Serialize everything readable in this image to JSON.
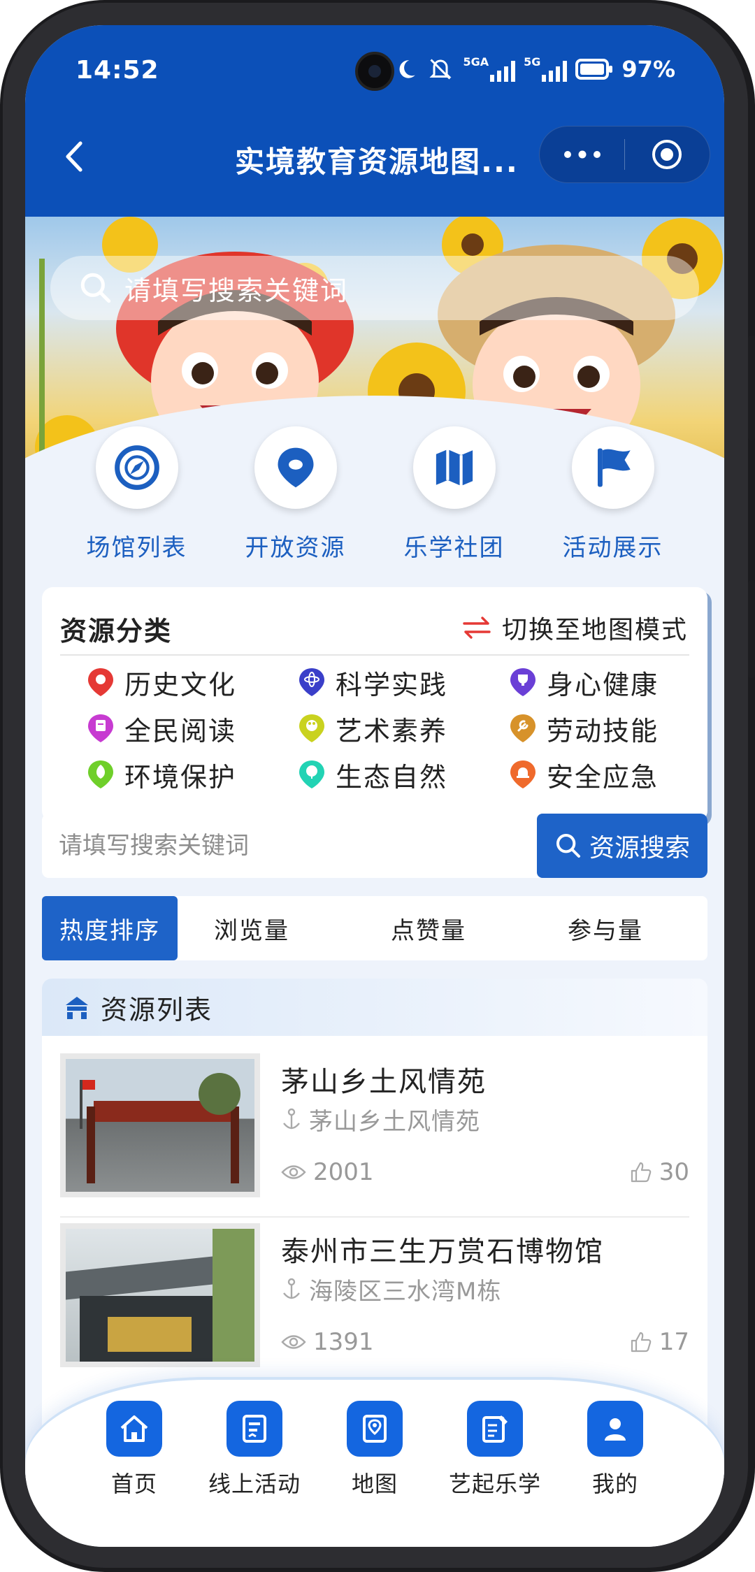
{
  "status": {
    "time": "14:52",
    "battery": "97%",
    "net1": "5GA",
    "net2": "5G"
  },
  "nav": {
    "title": "实境教育资源地图...",
    "more_icon": "more-dots-icon",
    "target_icon": "record-circle-icon"
  },
  "banner": {
    "search_placeholder": "请填写搜索关键词"
  },
  "quick": [
    {
      "label": "场馆列表",
      "icon": "compass-icon"
    },
    {
      "label": "开放资源",
      "icon": "location-pin-icon"
    },
    {
      "label": "乐学社团",
      "icon": "map-icon"
    },
    {
      "label": "活动展示",
      "icon": "flag-icon"
    }
  ],
  "categories": {
    "title": "资源分类",
    "switch_label": "切换至地图模式",
    "items": [
      {
        "label": "历史文化",
        "color": "#e53935"
      },
      {
        "label": "科学实践",
        "color": "#3a3fc9"
      },
      {
        "label": "身心健康",
        "color": "#6a3fd6"
      },
      {
        "label": "全民阅读",
        "color": "#c73bd1"
      },
      {
        "label": "艺术素养",
        "color": "#c9d21f"
      },
      {
        "label": "劳动技能",
        "color": "#d7922a"
      },
      {
        "label": "环境保护",
        "color": "#6fcf2a"
      },
      {
        "label": "生态自然",
        "color": "#22d3b4"
      },
      {
        "label": "安全应急",
        "color": "#ef6a2c"
      }
    ]
  },
  "search": {
    "placeholder": "请填写搜索关键词",
    "button": "资源搜索"
  },
  "sort": {
    "tabs": [
      "热度排序",
      "浏览量",
      "点赞量",
      "参与量"
    ],
    "active": 0
  },
  "list": {
    "title": "资源列表",
    "items": [
      {
        "title": "茅山乡土风情苑",
        "location": "茅山乡土风情苑",
        "views": "2001",
        "likes": "30"
      },
      {
        "title": "泰州市三生万赏石博物馆",
        "location": "海陵区三水湾M栋",
        "views": "1391",
        "likes": "17"
      }
    ]
  },
  "tabbar": [
    {
      "label": "首页",
      "icon": "home-icon"
    },
    {
      "label": "线上活动",
      "icon": "document-icon"
    },
    {
      "label": "地图",
      "icon": "map-pin-icon"
    },
    {
      "label": "艺起乐学",
      "icon": "edit-note-icon"
    },
    {
      "label": "我的",
      "icon": "user-icon"
    }
  ]
}
